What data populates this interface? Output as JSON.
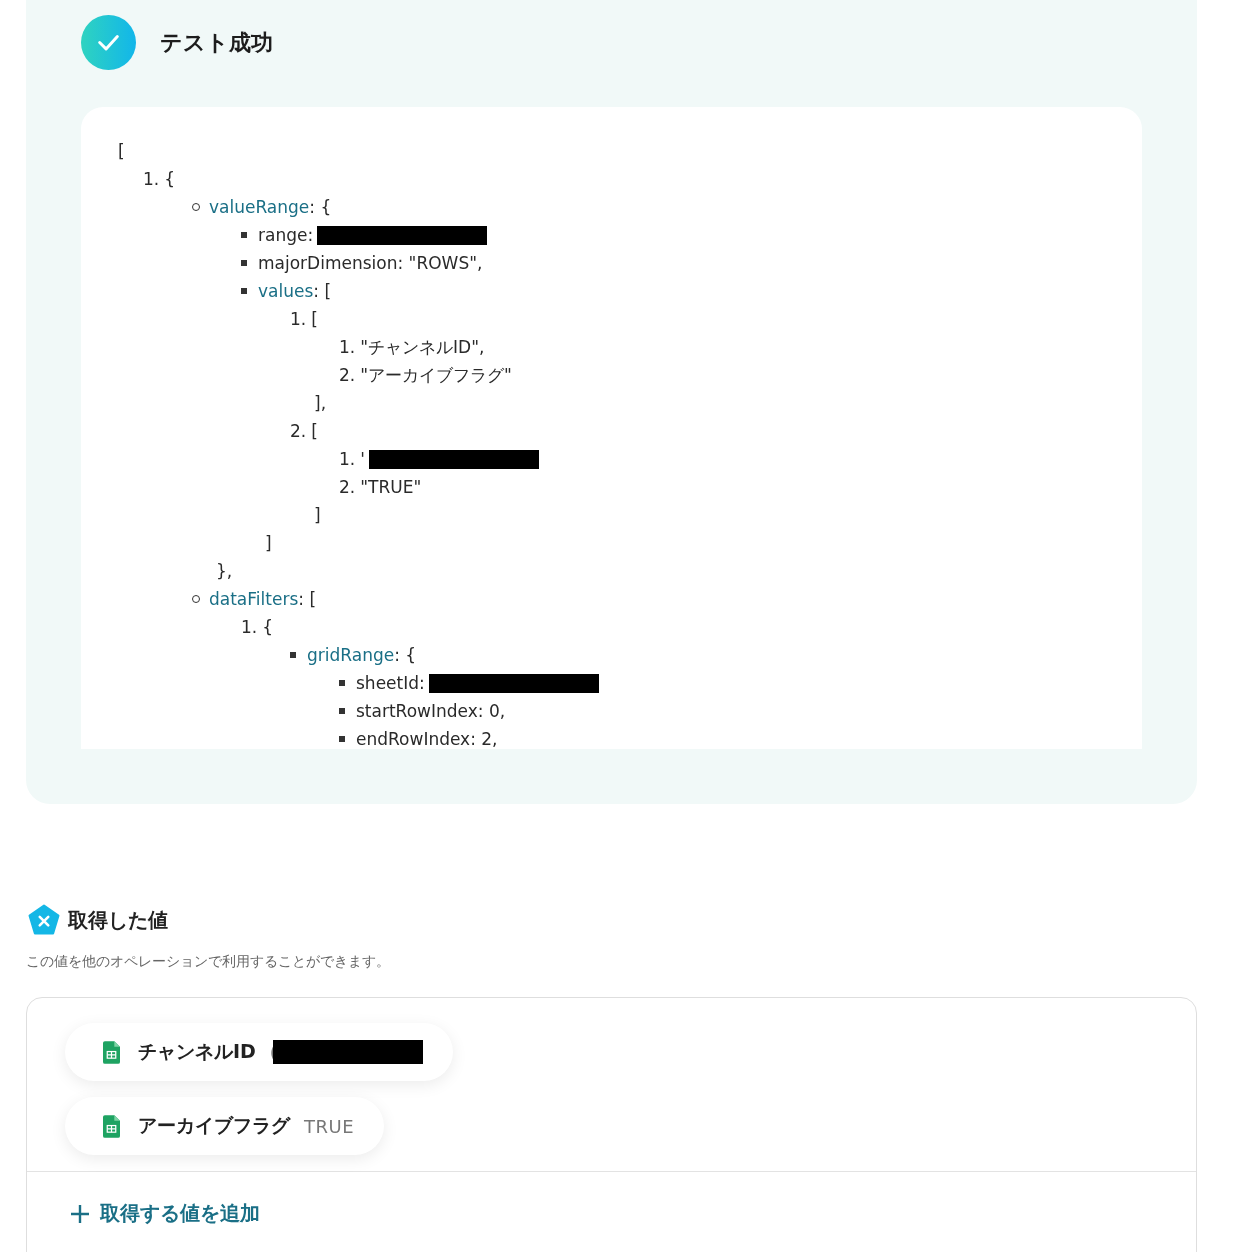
{
  "test_result": {
    "title": "テスト成功",
    "success": true,
    "code_lines": [
      {
        "kind": "plain",
        "text": "[",
        "children": [
          {
            "kind": "number",
            "num": "1.",
            "text": "{",
            "children": [
              {
                "kind": "circle",
                "key": "valueRange",
                "text": ": {",
                "close": "},",
                "children": [
                  {
                    "kind": "square",
                    "text": "range:",
                    "redacted": true
                  },
                  {
                    "kind": "square",
                    "text": "majorDimension: \"ROWS\","
                  },
                  {
                    "kind": "square",
                    "key": "values",
                    "text": ": [",
                    "close": "]",
                    "children": [
                      {
                        "kind": "number",
                        "num": "1.",
                        "text": "[",
                        "close": "],",
                        "children": [
                          {
                            "kind": "number",
                            "num": "1.",
                            "text": "\"チャンネルID\","
                          },
                          {
                            "kind": "number",
                            "num": "2.",
                            "text": "\"アーカイブフラグ\""
                          }
                        ]
                      },
                      {
                        "kind": "number",
                        "num": "2.",
                        "text": "[",
                        "close": "]",
                        "children": [
                          {
                            "kind": "number",
                            "num": "1.",
                            "text": "'",
                            "redacted": true
                          },
                          {
                            "kind": "number",
                            "num": "2.",
                            "text": "\"TRUE\""
                          }
                        ]
                      }
                    ]
                  }
                ]
              },
              {
                "kind": "circle",
                "key": "dataFilters",
                "text": ": [",
                "children": [
                  {
                    "kind": "number",
                    "num": "1.",
                    "text": "{",
                    "children": [
                      {
                        "kind": "square",
                        "key": "gridRange",
                        "text": ": {",
                        "children": [
                          {
                            "kind": "square",
                            "text": "sheetId:",
                            "redacted": true
                          },
                          {
                            "kind": "square",
                            "text": "startRowIndex: 0,"
                          },
                          {
                            "kind": "square",
                            "text": "endRowIndex: 2,"
                          }
                        ]
                      }
                    ]
                  }
                ]
              }
            ]
          }
        ]
      }
    ]
  },
  "retrieved_values": {
    "title": "取得した値",
    "description": "この値を他のオペレーションで利用することができます。",
    "items": [
      {
        "label": "チャンネルID",
        "value": "(",
        "redacted": true
      },
      {
        "label": "アーカイブフラグ",
        "value": "TRUE",
        "redacted": false
      }
    ],
    "add_link": "取得する値を追加"
  }
}
